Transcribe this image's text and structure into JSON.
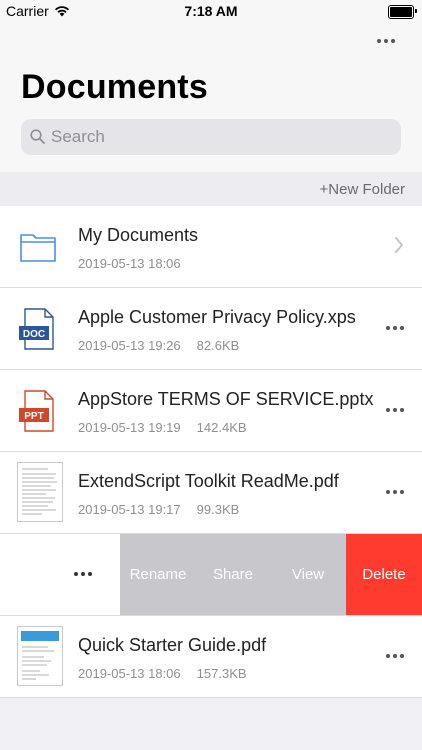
{
  "status": {
    "carrier": "Carrier",
    "time": "7:18 AM"
  },
  "header": {
    "title": "Documents"
  },
  "search": {
    "placeholder": "Search"
  },
  "folder_bar": {
    "new_folder": "+New Folder"
  },
  "files": [
    {
      "name": "My Documents",
      "date": "2019-05-13 18:06",
      "size": "",
      "icon": "folder-icon"
    },
    {
      "name": "Apple Customer Privacy Policy.xps",
      "date": "2019-05-13 19:26",
      "size": "82.6KB",
      "icon": "doc-file-icon",
      "badge": "DOC"
    },
    {
      "name": "AppStore TERMS OF SERVICE.pptx",
      "date": "2019-05-13 19:19",
      "size": "142.4KB",
      "icon": "ppt-file-icon",
      "badge": "PPT"
    },
    {
      "name": "ExtendScript Toolkit ReadMe.pdf",
      "date": "2019-05-13 19:17",
      "size": "99.3KB",
      "icon": "pdf-thumbnail"
    },
    {
      "name": "Quick Starter Guide.pdf",
      "date": "2019-05-13 18:06",
      "size": "157.3KB",
      "icon": "pdf-thumbnail"
    }
  ],
  "swipe_actions": {
    "rename": "Rename",
    "share": "Share",
    "view": "View",
    "delete": "Delete"
  },
  "colors": {
    "delete": "#ff3b30",
    "action_gray": "#c7c7cc",
    "doc_blue": "#2b579a",
    "ppt_orange": "#d24726",
    "folder_blue": "#4a90d9"
  }
}
